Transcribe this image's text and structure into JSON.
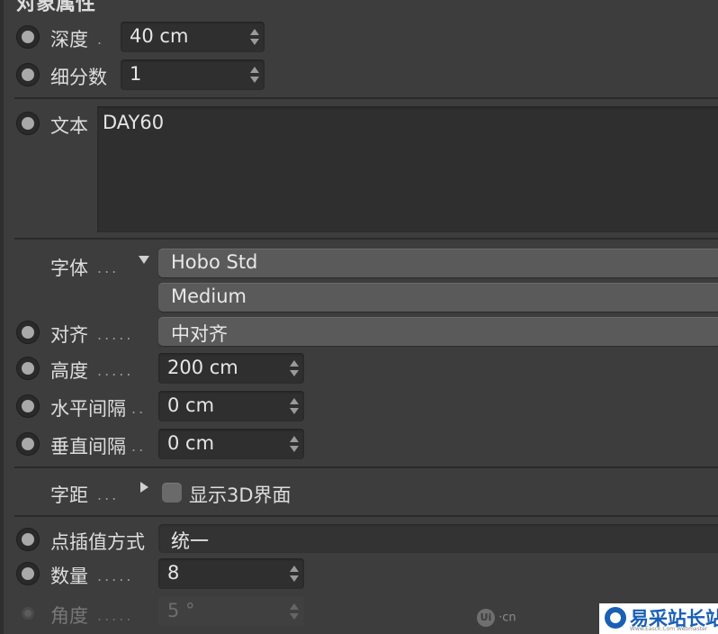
{
  "header": {
    "title": "对象属性"
  },
  "rows": {
    "depth": {
      "label": "深度",
      "value": "40 cm"
    },
    "subdivision": {
      "label": "细分数",
      "value": "1"
    },
    "text": {
      "label": "文本",
      "value": "DAY60"
    },
    "font": {
      "label": "字体",
      "family": "Hobo Std",
      "style": "Medium"
    },
    "align": {
      "label": "对齐",
      "value": "中对齐"
    },
    "height": {
      "label": "高度",
      "value": "200 cm"
    },
    "h_spacing": {
      "label": "水平间隔",
      "value": "0 cm"
    },
    "v_spacing": {
      "label": "垂直间隔",
      "value": "0 cm"
    },
    "kerning": {
      "label": "字距",
      "checkbox_label": "显示3D界面",
      "checked": false
    },
    "interpolation": {
      "label": "点插值方式",
      "value": "统一"
    },
    "count": {
      "label": "数量",
      "value": "8"
    },
    "angle": {
      "label": "角度",
      "value": "5 °"
    }
  },
  "dots": {
    "depth": ".",
    "subdivision": "",
    "font": "...",
    "align": ".....",
    "height": ".....",
    "h_spacing": "..",
    "v_spacing": "..",
    "kerning": "...",
    "count": ".....",
    "angle": "....."
  },
  "watermark": {
    "ui_badge": "Ui",
    "ui_text": "·cn",
    "brand": "易采站长站",
    "brand_sub": "Www.Easck.Com Webmaster"
  },
  "colors": {
    "panel_bg": "#3d3d3d",
    "field_bg": "#2f2f2f",
    "dropdown_bg": "#5a5a5a",
    "brand_blue": "#1a5fb4"
  }
}
